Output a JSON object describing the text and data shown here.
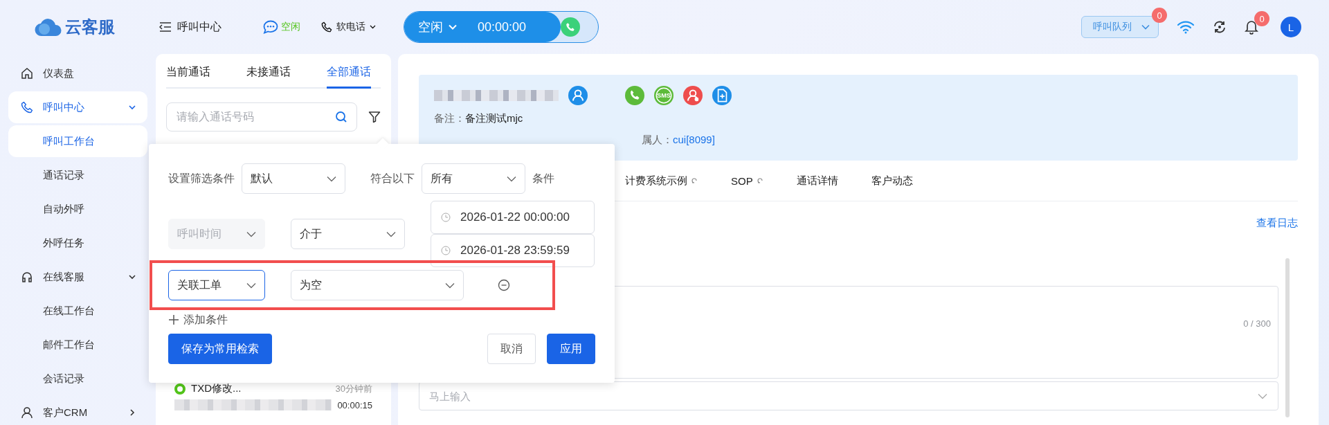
{
  "header": {
    "logo": "云客服",
    "menu_title": "呼叫中心",
    "agent_status": "空闲",
    "phone_mode": "软电话",
    "call_state": "空闲",
    "call_timer": "00:00:00",
    "queue_button": "呼叫队列",
    "queue_badge": "0",
    "notification_badge": "0",
    "avatar": "L"
  },
  "sidebar": {
    "items": [
      {
        "label": "仪表盘",
        "kind": "link",
        "selected": false
      },
      {
        "label": "呼叫中心",
        "kind": "group",
        "selected": true,
        "expanded": true,
        "children": [
          {
            "label": "呼叫工作台",
            "selected": true
          },
          {
            "label": "通话记录",
            "selected": false
          },
          {
            "label": "自动外呼",
            "selected": false
          },
          {
            "label": "外呼任务",
            "selected": false
          }
        ]
      },
      {
        "label": "在线客服",
        "kind": "group",
        "selected": false,
        "expanded": true,
        "children": [
          {
            "label": "在线工作台",
            "selected": false
          },
          {
            "label": "邮件工作台",
            "selected": false
          },
          {
            "label": "会话记录",
            "selected": false
          }
        ]
      },
      {
        "label": "客户CRM",
        "kind": "group",
        "selected": false,
        "expanded": false
      }
    ]
  },
  "calls": {
    "tabs": [
      {
        "label": "当前通话",
        "selected": false
      },
      {
        "label": "未接通话",
        "selected": false
      },
      {
        "label": "全部通话",
        "selected": true
      }
    ],
    "search": {
      "placeholder": "请输入通话号码"
    },
    "items": [
      {
        "name": "TXD修改...",
        "time": "30分钟前",
        "duration": "00:00:15"
      }
    ]
  },
  "filter_popup": {
    "title": "设置筛选条件",
    "preset": "默认",
    "match_prefix": "符合以下",
    "match": "所有",
    "match_suffix": "条件",
    "conditions": [
      {
        "field": "呼叫时间",
        "field_disabled": true,
        "focused": false,
        "operator": "介于",
        "values": [
          "2026-01-22 00:00:00",
          "2026-01-28 23:59:59"
        ],
        "highlighted": false,
        "removable": false
      },
      {
        "field": "关联工单",
        "field_disabled": false,
        "focused": true,
        "operator": "为空",
        "highlighted": true,
        "removable": true
      }
    ],
    "add_label": "添加条件",
    "save_button": "保存为常用检索",
    "cancel_button": "取消",
    "apply_button": "应用"
  },
  "customer": {
    "note_label": "备注：",
    "note": "备注测试mjc",
    "owner_label": "属人：",
    "owner": "cui[8099]",
    "actions": [
      {
        "kind": "profile"
      },
      {
        "kind": "call"
      },
      {
        "kind": "sms",
        "label": "SMS"
      },
      {
        "kind": "block"
      },
      {
        "kind": "note"
      }
    ]
  },
  "detail_tabs": [
    {
      "label": "计费系统示例",
      "icon": true
    },
    {
      "label": "SOP",
      "icon": true
    },
    {
      "label": "通话详情",
      "icon": false
    },
    {
      "label": "客户动态",
      "icon": false
    }
  ],
  "log_link": "查看日志",
  "remark": {
    "counter": "0 / 300"
  },
  "quick_input": {
    "placeholder": "马上输入"
  }
}
